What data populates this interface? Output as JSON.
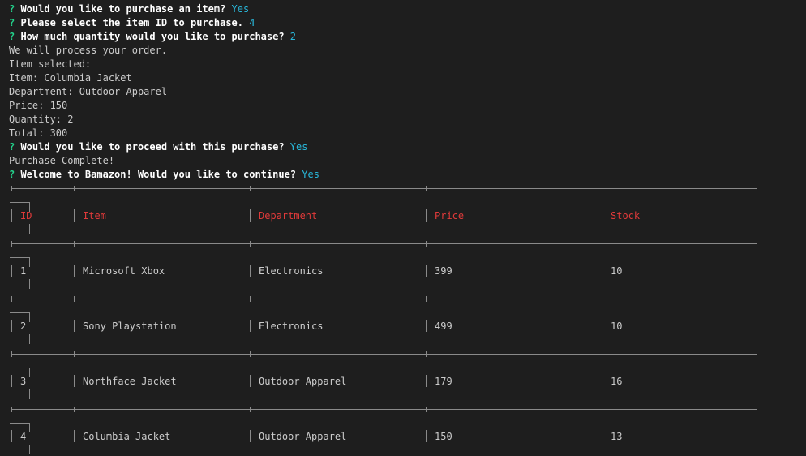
{
  "terminal": {
    "prompt_marker": "?",
    "lines": [
      {
        "type": "question",
        "text": "Would you like to purchase an item?",
        "answer": "Yes"
      },
      {
        "type": "question",
        "text": "Please select the item ID to purchase.",
        "answer": "4"
      },
      {
        "type": "question",
        "text": "How much quantity would you like to purchase?",
        "answer": "2"
      },
      {
        "type": "text",
        "text": "We will process your order."
      },
      {
        "type": "text",
        "text": "Item selected:"
      },
      {
        "type": "text",
        "text": "Item: Columbia Jacket"
      },
      {
        "type": "text",
        "text": "Department: Outdoor Apparel"
      },
      {
        "type": "text",
        "text": "Price: 150"
      },
      {
        "type": "text",
        "text": "Quantity: 2"
      },
      {
        "type": "text",
        "text": "Total: 300"
      },
      {
        "type": "question",
        "text": "Would you like to proceed with this purchase?",
        "answer": "Yes"
      },
      {
        "type": "text",
        "text": "Purchase Complete!"
      },
      {
        "type": "question",
        "text": "Welcome to Bamazon! Would you like to continue?",
        "answer": "Yes"
      }
    ]
  },
  "table": {
    "headers": [
      "ID",
      "Item",
      "Department",
      "Price",
      "Stock"
    ],
    "rows": [
      [
        "1",
        "Microsoft Xbox",
        "Electronics",
        "399",
        "10"
      ],
      [
        "2",
        "Sony Playstation",
        "Electronics",
        "499",
        "10"
      ],
      [
        "3",
        "Northface Jacket",
        "Outdoor Apparel",
        "179",
        "16"
      ],
      [
        "4",
        "Columbia Jacket",
        "Outdoor Apparel",
        "150",
        "13"
      ]
    ]
  },
  "colors": {
    "background": "#1e1e1e",
    "prompt_marker": "#23d18b",
    "answer": "#29b8db",
    "header": "#e03a3a",
    "text": "#cccccc"
  }
}
